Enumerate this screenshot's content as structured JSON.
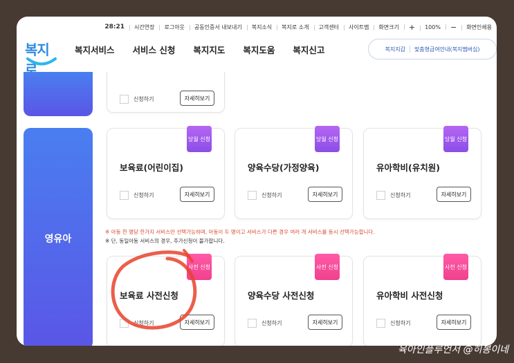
{
  "topbar": {
    "time": "28:21",
    "links": [
      "시간연장",
      "로그아웃",
      "공동인증서 내보내기",
      "복지소식",
      "복지로 소개",
      "고객센터",
      "사이트맵",
      "화면크기"
    ],
    "zoom_plus": "+",
    "zoom_level": "100%",
    "zoom_minus": "−",
    "print": "화면인쇄용"
  },
  "logo": {
    "text": "복지로"
  },
  "gnb": [
    "복지서비스",
    "서비스 신청",
    "복지지도",
    "복지도움",
    "복지신고"
  ],
  "pill": {
    "left": "복지지갑",
    "right": "맞춤형급여안내(복지멤버십)"
  },
  "sidebar": {
    "category": "영유아"
  },
  "cards": {
    "apply_label": "신청하기",
    "detail_label": "자세히보기",
    "row1": [
      {
        "badge": "당월 신청",
        "title": "보육료(어린이집)"
      },
      {
        "badge": "당월 신청",
        "title": "양육수당(가정양육)"
      },
      {
        "badge": "당월 신청",
        "title": "유아학비(유치원)"
      }
    ],
    "row2": [
      {
        "badge": "사전 신청",
        "title": "보육료 사전신청"
      },
      {
        "badge": "사전 신청",
        "title": "양육수당 사전신청"
      },
      {
        "badge": "사전 신청",
        "title": "유아학비 사전신청"
      }
    ]
  },
  "notes": {
    "line1": "※ 아동 한 명당 한가지 서비스만 선택가능하며, 아동이 두 명이고 서비스가 다른 경우 여러 개 서비스를 동시 선택가능합니다.",
    "line2": "※ 단, 동일아동 서비스의 경우, 추가신청이 불가합니다."
  },
  "watermark": "육아인플루언서 @히봉이네",
  "colors": {
    "accent_blue": "#4a7ef0",
    "badge_purple": "#9b57ea",
    "badge_pink": "#f5479a",
    "annotation_red": "#e8432c"
  }
}
